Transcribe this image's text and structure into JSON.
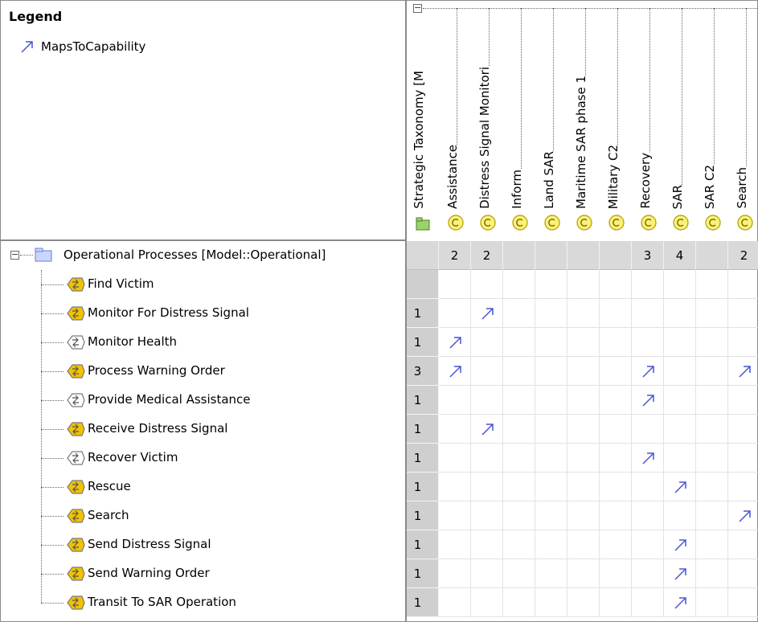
{
  "legend": {
    "title": "Legend",
    "items": [
      {
        "label": "MapsToCapability",
        "icon": "maps-to-capability-arrow-icon",
        "color": "#4a54d0"
      }
    ]
  },
  "columns": {
    "root_label": "Strategic Taxonomy [M",
    "root_icon": "package-icon",
    "items": [
      {
        "label": "Assistance",
        "icon": "capability-icon"
      },
      {
        "label": "Distress Signal Monitori",
        "icon": "capability-icon"
      },
      {
        "label": "Inform",
        "icon": "capability-icon"
      },
      {
        "label": "Land SAR",
        "icon": "capability-icon"
      },
      {
        "label": "Maritime SAR phase 1",
        "icon": "capability-icon"
      },
      {
        "label": "Military C2",
        "icon": "capability-icon"
      },
      {
        "label": "Recovery",
        "icon": "capability-icon"
      },
      {
        "label": "SAR",
        "icon": "capability-icon"
      },
      {
        "label": "SAR C2",
        "icon": "capability-icon"
      },
      {
        "label": "Search",
        "icon": "capability-icon"
      }
    ],
    "totals": [
      "2",
      "2",
      "",
      "",
      "",
      "",
      "3",
      "4",
      "",
      "2"
    ]
  },
  "rows": {
    "root_label": "Operational Processes [Model::Operational]",
    "root_icon": "package-icon",
    "items": [
      {
        "label": "Find Victim",
        "count": "",
        "cells": [
          0,
          0,
          0,
          0,
          0,
          0,
          0,
          0,
          0,
          0
        ],
        "icon_color": "#f2c200"
      },
      {
        "label": "Monitor For Distress Signal",
        "count": "1",
        "cells": [
          0,
          1,
          0,
          0,
          0,
          0,
          0,
          0,
          0,
          0
        ],
        "icon_color": "#f2c200"
      },
      {
        "label": "Monitor Health",
        "count": "1",
        "cells": [
          1,
          0,
          0,
          0,
          0,
          0,
          0,
          0,
          0,
          0
        ],
        "icon_color": "#ffffff"
      },
      {
        "label": "Process Warning Order",
        "count": "3",
        "cells": [
          1,
          0,
          0,
          0,
          0,
          0,
          1,
          0,
          0,
          1
        ],
        "icon_color": "#f2c200"
      },
      {
        "label": "Provide Medical Assistance",
        "count": "1",
        "cells": [
          0,
          0,
          0,
          0,
          0,
          0,
          1,
          0,
          0,
          0
        ],
        "icon_color": "#ffffff"
      },
      {
        "label": "Receive Distress Signal",
        "count": "1",
        "cells": [
          0,
          1,
          0,
          0,
          0,
          0,
          0,
          0,
          0,
          0
        ],
        "icon_color": "#f2c200"
      },
      {
        "label": "Recover Victim",
        "count": "1",
        "cells": [
          0,
          0,
          0,
          0,
          0,
          0,
          1,
          0,
          0,
          0
        ],
        "icon_color": "#ffffff"
      },
      {
        "label": "Rescue",
        "count": "1",
        "cells": [
          0,
          0,
          0,
          0,
          0,
          0,
          0,
          1,
          0,
          0
        ],
        "icon_color": "#f2c200"
      },
      {
        "label": "Search",
        "count": "1",
        "cells": [
          0,
          0,
          0,
          0,
          0,
          0,
          0,
          0,
          0,
          1
        ],
        "icon_color": "#f2c200"
      },
      {
        "label": "Send Distress Signal",
        "count": "1",
        "cells": [
          0,
          0,
          0,
          0,
          0,
          0,
          0,
          1,
          0,
          0
        ],
        "icon_color": "#f2c200"
      },
      {
        "label": "Send Warning Order",
        "count": "1",
        "cells": [
          0,
          0,
          0,
          0,
          0,
          0,
          0,
          1,
          0,
          0
        ],
        "icon_color": "#f2c200"
      },
      {
        "label": "Transit To SAR Operation",
        "count": "1",
        "cells": [
          0,
          0,
          0,
          0,
          0,
          0,
          0,
          1,
          0,
          0
        ],
        "icon_color": "#f2c200"
      }
    ]
  },
  "colors": {
    "arrow": "#4a54d0",
    "capability_fill": "#f7f27a",
    "header_gray": "#cfcfcf"
  }
}
